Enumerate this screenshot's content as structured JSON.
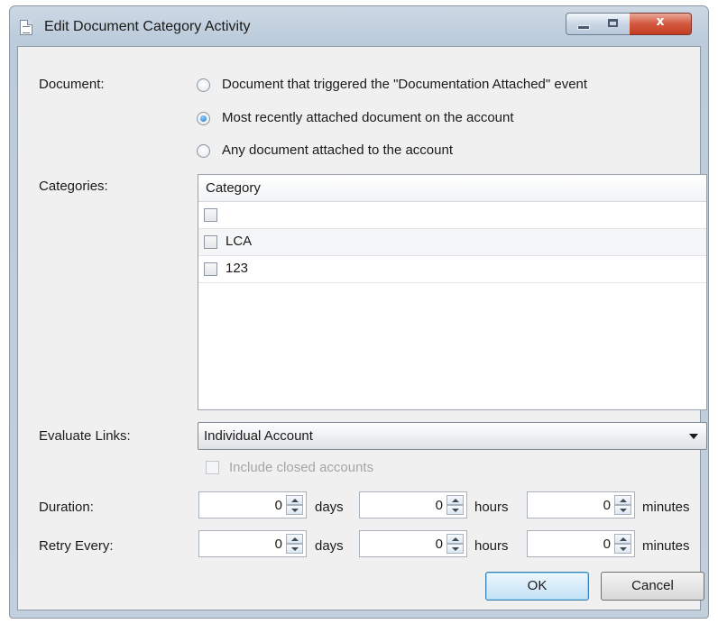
{
  "window": {
    "title": "Edit Document Category Activity",
    "controls": {
      "minimize_icon": "minimize-icon",
      "maximize_icon": "maximize-icon",
      "close_label": "x"
    }
  },
  "document": {
    "label": "Document:",
    "options": [
      {
        "label": "Document that triggered the \"Documentation Attached\" event",
        "selected": false
      },
      {
        "label": "Most recently attached document on the account",
        "selected": true
      },
      {
        "label": "Any document attached to the account",
        "selected": false
      }
    ]
  },
  "categories": {
    "label": "Categories:",
    "column_header": "Category",
    "rows": [
      {
        "label": "",
        "checked": false
      },
      {
        "label": "LCA",
        "checked": false
      },
      {
        "label": "123",
        "checked": false
      }
    ]
  },
  "evaluate_links": {
    "label": "Evaluate Links:",
    "selected": "Individual Account"
  },
  "include_closed": {
    "label": "Include closed accounts",
    "checked": false,
    "enabled": false
  },
  "duration": {
    "label": "Duration:",
    "days": "0",
    "hours": "0",
    "minutes": "0",
    "days_unit": "days",
    "hours_unit": "hours",
    "minutes_unit": "minutes"
  },
  "retry_every": {
    "label": "Retry Every:",
    "days": "0",
    "hours": "0",
    "minutes": "0",
    "days_unit": "days",
    "hours_unit": "hours",
    "minutes_unit": "minutes"
  },
  "buttons": {
    "ok": "OK",
    "cancel": "Cancel"
  },
  "colors": {
    "title_bar": "#c3cfdc",
    "close_button": "#c43f22",
    "dialog_body": "#f0f0f0",
    "default_button_border": "#3c7fb1"
  }
}
